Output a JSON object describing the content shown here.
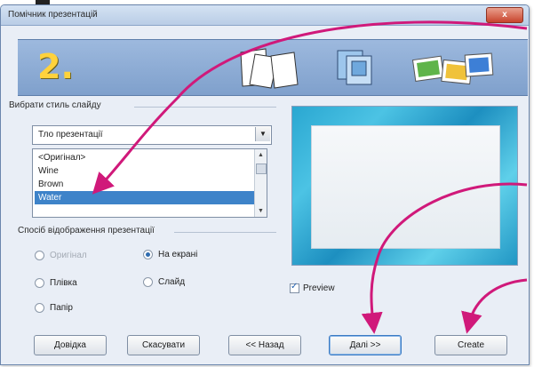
{
  "window": {
    "title": "Помічник презентацій",
    "close_label": "x"
  },
  "header": {
    "step_number": "2.",
    "icons": [
      "slides-stack-icon",
      "layered-slides-icon",
      "photo-slides-icon"
    ]
  },
  "slide_style": {
    "group_label": "Вибрати стиль слайду",
    "combo_value": "Тло презентації",
    "list_items": [
      "<Оригінал>",
      "Wine",
      "Brown",
      "Water"
    ],
    "selected_item": "Water"
  },
  "output_medium": {
    "group_label": "Спосіб відображення презентації",
    "options": [
      {
        "label": "Оригінал",
        "checked": false,
        "disabled": true
      },
      {
        "label": "На екрані",
        "checked": true,
        "disabled": false
      },
      {
        "label": "Плівка",
        "checked": false,
        "disabled": false
      },
      {
        "label": "Слайд",
        "checked": false,
        "disabled": false
      },
      {
        "label": "Папір",
        "checked": false,
        "disabled": false
      }
    ]
  },
  "preview": {
    "checkbox_label": "Preview",
    "checked": true
  },
  "buttons": {
    "help": "Довідка",
    "cancel": "Скасувати",
    "back": "<< Назад",
    "next": "Далі >>",
    "create": "Create"
  },
  "colors": {
    "accent": "#3e83c9",
    "annotation_arrow": "#d0197a",
    "step_number": "#ffd23c"
  }
}
